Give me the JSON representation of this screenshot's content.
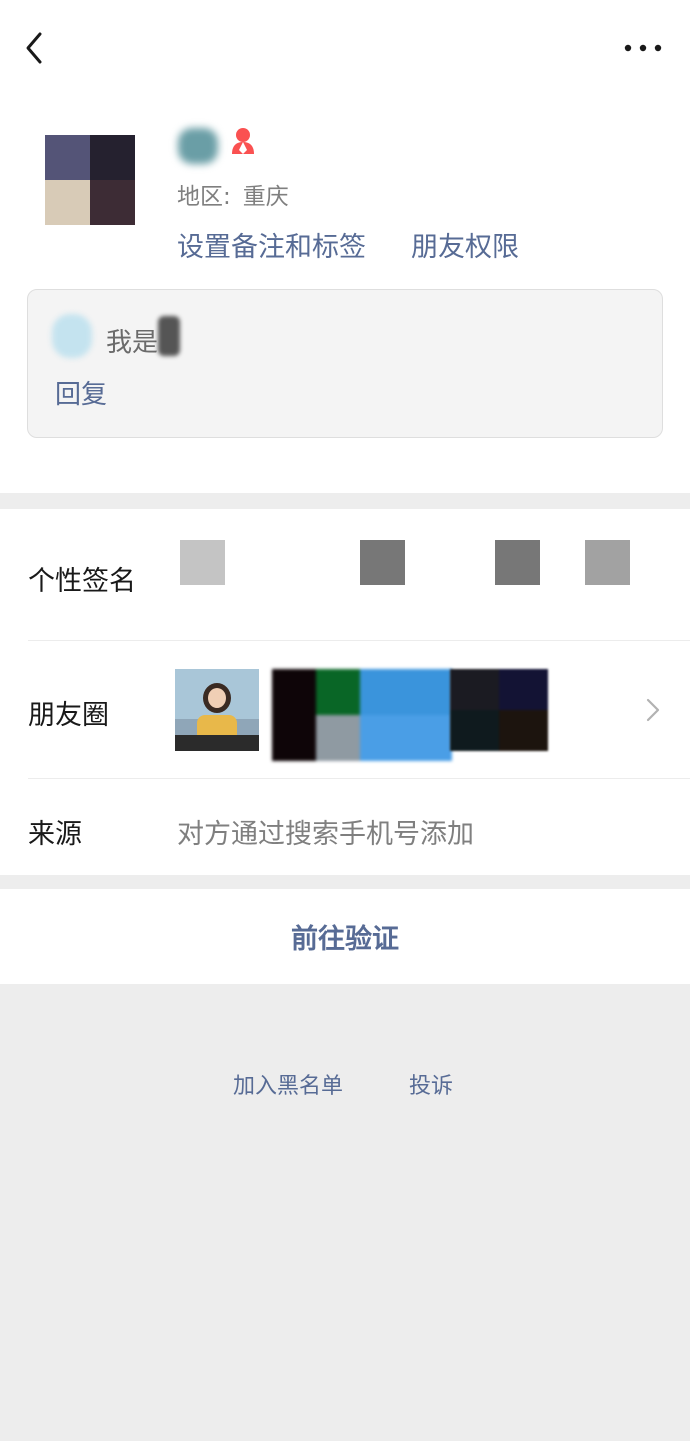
{
  "nav": {
    "back_icon": "chevron-left-icon",
    "more_icon": "more-dots-icon"
  },
  "profile": {
    "gender_icon": "female-person-icon",
    "gender_color": "#fa5151",
    "region_label": "地区:",
    "region_value": "重庆",
    "remark_tags_link": "设置备注和标签",
    "friend_permissions_link": "朋友权限"
  },
  "greeting": {
    "message_text": "我是",
    "reply_label": "回复"
  },
  "info": {
    "signature_label": "个性签名",
    "moments_label": "朋友圈",
    "source_label": "来源",
    "source_value": "对方通过搜索手机号添加"
  },
  "actions": {
    "verify_button": "前往验证",
    "blacklist_link": "加入黑名单",
    "report_link": "投诉"
  },
  "colors": {
    "link": "#576b95",
    "page_bg": "#ededed",
    "card_bg": "#f4f4f4"
  }
}
